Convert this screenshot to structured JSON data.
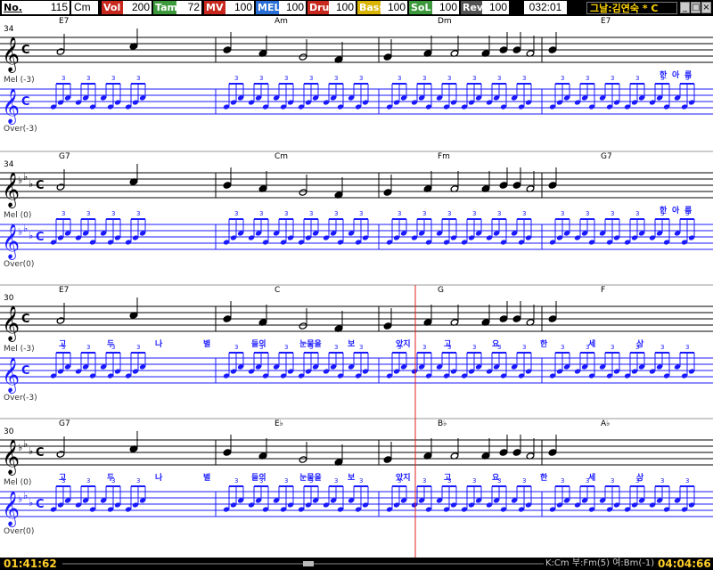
{
  "toolbar": {
    "no_label": "No.",
    "number": "115",
    "key": "Cm",
    "items": [
      {
        "label": "Vol",
        "value": "200",
        "color": "#c8281e"
      },
      {
        "label": "Tamp",
        "value": "72",
        "color": "#3c9a3c"
      },
      {
        "label": "MV",
        "value": "100",
        "color": "#c8281e"
      },
      {
        "label": "MEL",
        "value": "100",
        "color": "#2a6fd6"
      },
      {
        "label": "Dru",
        "value": "100",
        "color": "#c8281e"
      },
      {
        "label": "Bass",
        "value": "100",
        "color": "#d9b400"
      },
      {
        "label": "SoL",
        "value": "100",
        "color": "#3c9a3c"
      },
      {
        "label": "Rev",
        "value": "100",
        "color": "#555555"
      }
    ],
    "position": "032:01",
    "song_title": "그날:김연숙 * C",
    "window_buttons": [
      "_",
      "□",
      "×"
    ]
  },
  "systems": [
    {
      "tempo": "34",
      "chords": [
        "E7",
        "Am",
        "Dm",
        "E7"
      ],
      "mel_label": "Mel (-3)",
      "over_label": "Over(-3)",
      "key_sig": "c",
      "lyrics": [
        "",
        "",
        "",
        "",
        "",
        "",
        "",
        "",
        "",
        "",
        "",
        "",
        "",
        "",
        "",
        "",
        "",
        "",
        "",
        "",
        "",
        "",
        "",
        "",
        "",
        "",
        "",
        "",
        "",
        "",
        "",
        "",
        "",
        "",
        "한",
        "아",
        "름"
      ]
    },
    {
      "tempo": "34",
      "chords": [
        "G7",
        "Cm",
        "Fm",
        "G7"
      ],
      "mel_label": "Mel (0)",
      "over_label": "Over(0)",
      "key_sig": "cm",
      "lyrics": [
        "한",
        "아",
        "름"
      ]
    },
    {
      "tempo": "30",
      "chords": [
        "E7",
        "C",
        "G",
        "F"
      ],
      "mel_label": "Mel (-3)",
      "over_label": "Over(-3)",
      "key_sig": "c",
      "lyrics": [
        "고",
        "두",
        "나",
        "별",
        "들의",
        "눈물을",
        "보",
        "았지",
        "고",
        "요",
        "한",
        "세",
        "상"
      ]
    },
    {
      "tempo": "30",
      "chords": [
        "G7",
        "E♭",
        "B♭",
        "A♭"
      ],
      "mel_label": "Mel (0)",
      "over_label": "Over(0)",
      "key_sig": "cm",
      "lyrics": [
        "고",
        "두",
        "나",
        "별",
        "들의",
        "눈물을",
        "보",
        "았지",
        "고",
        "요",
        "한",
        "세",
        "상"
      ]
    }
  ],
  "status": {
    "elapsed": "01:41:62",
    "chord_info": "K:Cm 부:Fm(5) 여:Bm(-1)",
    "total": "04:04:66"
  },
  "colors": {
    "accent_blue": "#1a1aff",
    "playhead": "#e02020",
    "status_yellow": "#ffcf2a",
    "title_yellow": "#ffd400"
  }
}
